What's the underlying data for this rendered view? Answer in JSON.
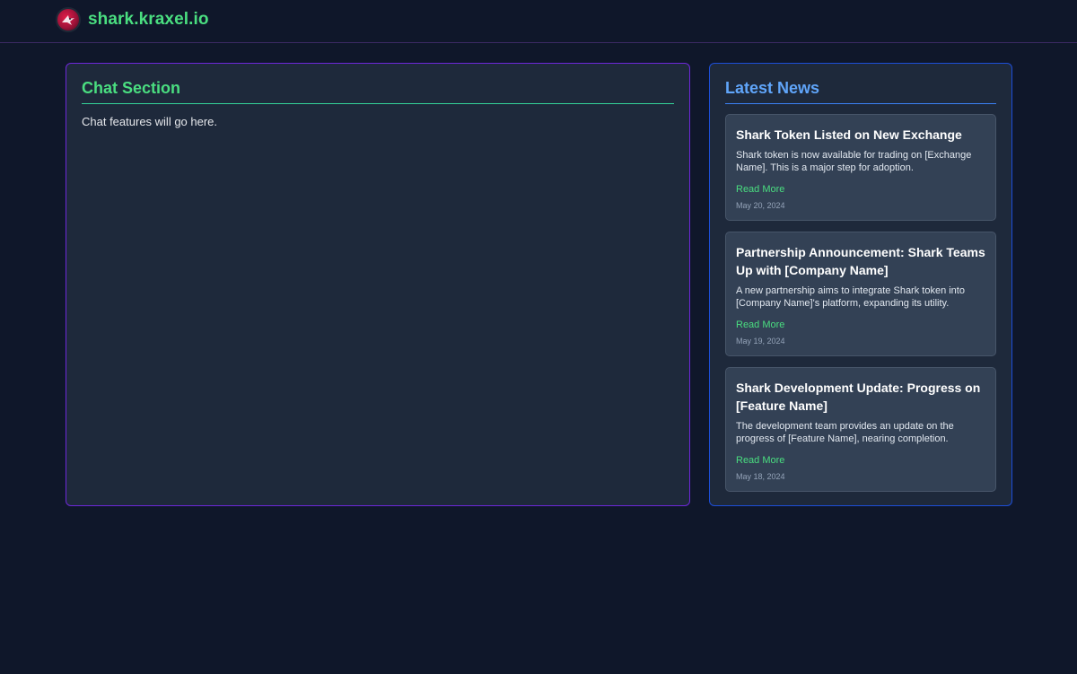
{
  "header": {
    "brand_name": "shark.kraxel.io",
    "logo_icon": "shark-logo-icon"
  },
  "chat": {
    "title": "Chat Section",
    "placeholder_text": "Chat features will go here."
  },
  "news": {
    "title": "Latest News",
    "items": [
      {
        "title": "Shark Token Listed on New Exchange",
        "body": "Shark token is now available for trading on [Exchange Name]. This is a major step for adoption.",
        "link_label": "Read More",
        "date": "May 20, 2024"
      },
      {
        "title": "Partnership Announcement: Shark Teams Up with [Company Name]",
        "body": "A new partnership aims to integrate Shark token into [Company Name]'s platform, expanding its utility.",
        "link_label": "Read More",
        "date": "May 19, 2024"
      },
      {
        "title": "Shark Development Update: Progress on [Feature Name]",
        "body": "The development team provides an update on the progress of [Feature Name], nearing completion.",
        "link_label": "Read More",
        "date": "May 18, 2024"
      }
    ]
  },
  "colors": {
    "background": "#0f172a",
    "card": "#1e293b",
    "news_item": "#334155",
    "accent_green": "#4ade80",
    "accent_blue": "#60a5fa",
    "chat_border": "#6d28d9",
    "news_border": "#1d4ed8"
  }
}
